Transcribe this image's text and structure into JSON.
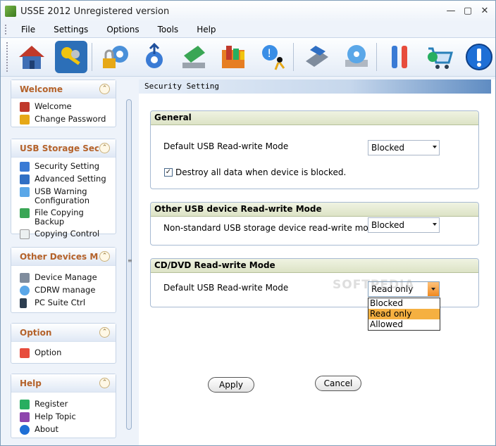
{
  "window": {
    "title": "USSE 2012 Unregistered version"
  },
  "menu": [
    "File",
    "Settings",
    "Options",
    "Tools",
    "Help"
  ],
  "toolbar": {
    "icons": [
      "home-icon",
      "keys-icon",
      "lock-gear-icon",
      "usb-gear-icon",
      "drive-icon",
      "folder-chart-icon",
      "run-icon",
      "usb-device-icon",
      "cd-drive-icon",
      "tools-icon",
      "cart-icon",
      "info-icon"
    ]
  },
  "sidebar": {
    "groups": [
      {
        "title": "Welcome",
        "items": [
          "Welcome",
          "Change Password"
        ]
      },
      {
        "title": "USB Storage Secu...",
        "items": [
          "Security Setting",
          "Advanced Setting",
          "USB Warning Configuration",
          "File Copying Backup",
          "Copying Control"
        ]
      },
      {
        "title": "Other Devices Ma...",
        "items": [
          "Device Manage",
          "CDRW manage",
          "PC Suite Ctrl"
        ]
      },
      {
        "title": "Option",
        "items": [
          "Option"
        ]
      },
      {
        "title": "Help",
        "items": [
          "Register",
          "Help Topic",
          "About"
        ]
      }
    ]
  },
  "content": {
    "section_title": "Security Setting",
    "general": {
      "title": "General",
      "label": "Default USB Read-write Mode",
      "value": "Blocked",
      "checkbox_label": "Destroy all data when device is blocked.",
      "checked": true
    },
    "other": {
      "title": "Other USB device Read-write Mode",
      "label": "Non-standard USB storage device read-write mode",
      "value": "Blocked"
    },
    "cddvd": {
      "title": "CD/DVD Read-write Mode",
      "label": "Default USB Read-write Mode",
      "value": "Read only",
      "options": [
        "Blocked",
        "Read only",
        "Allowed"
      ],
      "highlighted": "Read only"
    },
    "apply_label": "Apply",
    "cancel_label": "Cancel",
    "watermark": "SOFTPEDIA"
  },
  "colors": {
    "group_title": "#b4622a",
    "highlight": "#f5b041",
    "panel_header": "#dde3c6"
  }
}
